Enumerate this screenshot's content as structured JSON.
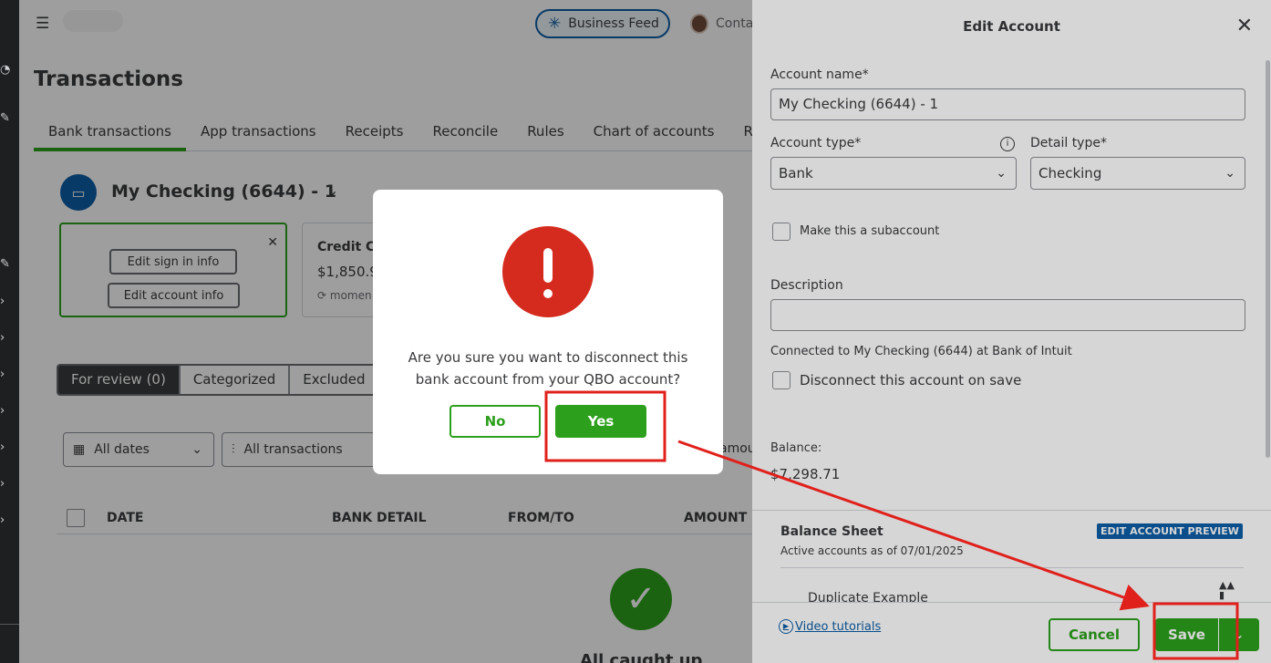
{
  "left_rail": {
    "icons": [
      "circle-icon",
      "pencil-icon",
      "pencil-icon",
      "chevron-right-icon",
      "chevron-right-icon",
      "chevron-right-icon",
      "chevron-right-icon",
      "chevron-right-icon",
      "chevron-right-icon",
      "chevron-right-icon"
    ]
  },
  "header": {
    "business_feed_label": "Business Feed",
    "contacts_label": "Conta"
  },
  "page": {
    "title": "Transactions",
    "tabs": [
      "Bank transactions",
      "App transactions",
      "Receipts",
      "Reconcile",
      "Rules",
      "Chart of accounts",
      "Rec"
    ],
    "active_tab": "Bank transactions"
  },
  "account": {
    "name": "My Checking (6644) - 1",
    "card": {
      "edit_sign_in_label": "Edit sign in info",
      "edit_account_label": "Edit account info"
    },
    "credit_card": {
      "title": "Credit C",
      "amount": "$1,850.9",
      "status": "momen"
    }
  },
  "review_tabs": [
    "For review (0)",
    "Categorized",
    "Excluded"
  ],
  "filters": {
    "dates_label": "All dates",
    "transactions_label": "All transactions",
    "amount_partial": "amou"
  },
  "table": {
    "columns": [
      "DATE",
      "BANK DETAIL",
      "FROM/TO",
      "AMOUNT"
    ],
    "empty_text": "All caught up"
  },
  "modal": {
    "message_line1": "Are you sure you want to disconnect this",
    "message_line2": "bank account from your QBO account?",
    "no_label": "No",
    "yes_label": "Yes"
  },
  "panel": {
    "title": "Edit Account",
    "account_name_label": "Account name*",
    "account_name_value": "My Checking (6644) - 1",
    "account_type_label": "Account type*",
    "account_type_value": "Bank",
    "detail_type_label": "Detail type*",
    "detail_type_value": "Checking",
    "subaccount_label": "Make this a subaccount",
    "description_label": "Description",
    "description_value": "",
    "connected_text": "Connected to My Checking (6644) at Bank of Intuit",
    "disconnect_label": "Disconnect this account on save",
    "balance_label": "Balance:",
    "balance_value": "$7,298.71",
    "preview": {
      "title": "Balance Sheet",
      "badge": "EDIT ACCOUNT PREVIEW",
      "subtitle": "Active accounts as of 07/01/2025",
      "row": "Duplicate Example"
    },
    "footer": {
      "video_label": "Video tutorials",
      "cancel_label": "Cancel",
      "save_label": "Save"
    }
  },
  "colors": {
    "brand_green": "#2ca01c",
    "brand_blue": "#0d5ea6",
    "error_red": "#d52b1e",
    "annotation_red": "#e0201b"
  }
}
